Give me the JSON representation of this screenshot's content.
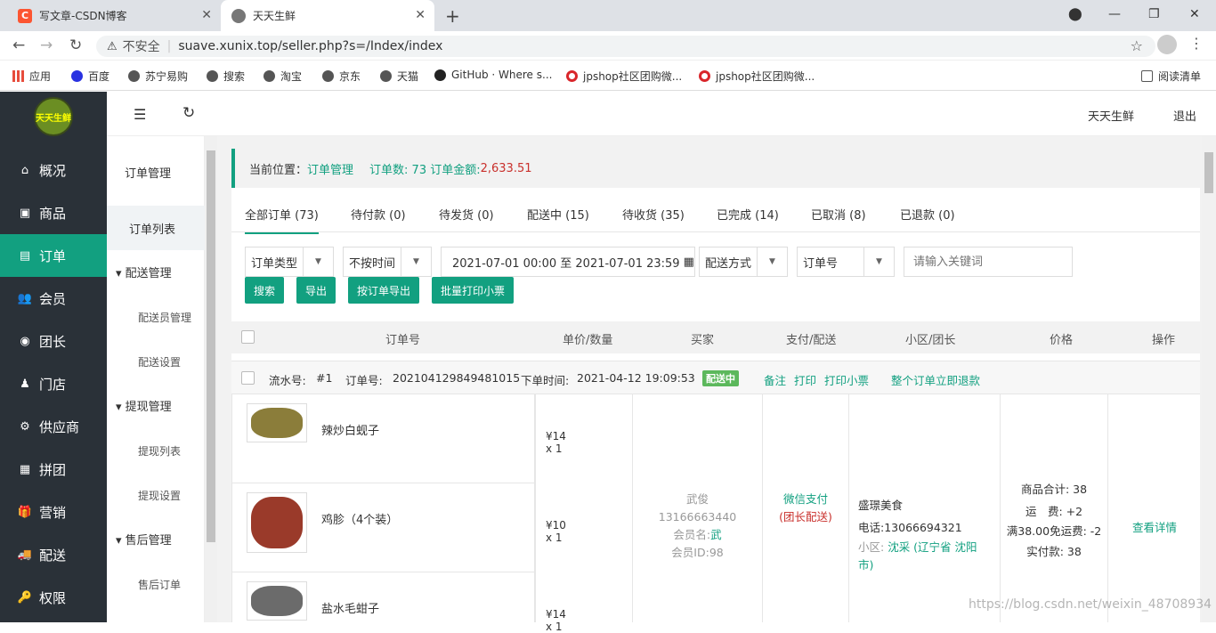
{
  "browser": {
    "tabs": [
      {
        "title": "写文章-CSDN博客",
        "favicon": "C"
      },
      {
        "title": "天天生鲜",
        "favicon": "globe"
      }
    ],
    "security_label": "不安全",
    "url": "suave.xunix.top/seller.php?s=/Index/index"
  },
  "bookmarks": [
    "应用",
    "百度",
    "苏宁易购",
    "搜索",
    "淘宝",
    "京东",
    "天猫",
    "GitHub · Where s...",
    "jpshop社区团购微...",
    "jpshop社区团购微...",
    "阅读清单"
  ],
  "sidebar": {
    "logo_text": "天天生鲜",
    "items": [
      {
        "label": "概况",
        "icon": "home-icon"
      },
      {
        "label": "商品",
        "icon": "inbox-icon"
      },
      {
        "label": "订单",
        "icon": "document-icon"
      },
      {
        "label": "会员",
        "icon": "users-icon"
      },
      {
        "label": "团长",
        "icon": "badge-icon"
      },
      {
        "label": "门店",
        "icon": "store-icon"
      },
      {
        "label": "供应商",
        "icon": "supplier-icon"
      },
      {
        "label": "拼团",
        "icon": "group-icon"
      },
      {
        "label": "营销",
        "icon": "gift-icon"
      },
      {
        "label": "配送",
        "icon": "truck-icon"
      },
      {
        "label": "权限",
        "icon": "key-icon"
      }
    ]
  },
  "subnav": {
    "title": "订单管理",
    "current": "订单列表",
    "groups": [
      {
        "label": "配送管理",
        "subs": [
          "配送员管理",
          "配送设置"
        ]
      },
      {
        "label": "提现管理",
        "subs": [
          "提现列表",
          "提现设置"
        ]
      },
      {
        "label": "售后管理",
        "subs": [
          "售后订单"
        ]
      }
    ]
  },
  "topbar": {
    "shop_name": "天天生鲜",
    "logout": "退出"
  },
  "breadcrumb": {
    "prefix": "当前位置：",
    "location": "订单管理",
    "summary_label": "订单数: 73 订单金额: ",
    "amount": "2,633.51"
  },
  "order_tabs": [
    "全部订单 (73)",
    "待付款 (0)",
    "待发货 (0)",
    "配送中 (15)",
    "待收货 (35)",
    "已完成 (14)",
    "已取消 (8)",
    "已退款 (0)"
  ],
  "filters": {
    "order_type": "订单类型",
    "time_mode": "不按时间",
    "date_range": "2021-07-01 00:00 至 2021-07-01 23:59",
    "delivery": "配送方式",
    "field": "订单号",
    "keyword_placeholder": "请输入关键词"
  },
  "buttons": {
    "search": "搜索",
    "export": "导出",
    "export_by_order": "按订单导出",
    "batch_print": "批量打印小票"
  },
  "table_header": [
    "订单号",
    "单价/数量",
    "买家",
    "支付/配送",
    "小区/团长",
    "价格",
    "操作"
  ],
  "order": {
    "serial_label": "流水号:",
    "serial": "#1",
    "order_no_label": "订单号:",
    "order_no": "202104129849481015",
    "time_label": "下单时间:",
    "time": "2021-04-12  19:09:53",
    "status": "配送中",
    "actions": [
      "备注",
      "打印",
      "打印小票",
      "整个订单立即退款"
    ],
    "products": [
      {
        "name": "辣炒白蚬子",
        "price": "¥14 x 1"
      },
      {
        "name": "鸡胗（4个装）",
        "price": "¥10 x 1"
      },
      {
        "name": "盐水毛蚶子",
        "price": "¥14 x 1"
      }
    ],
    "buyer": {
      "name": "武俊",
      "phone": "13166663440",
      "member_label": "会员名:",
      "member_name": "武",
      "id_label": "会员ID:",
      "id": "98"
    },
    "payment": {
      "method": "微信支付",
      "delivery": "(团长配送)"
    },
    "community": {
      "name": "盛璟美食",
      "phone_label": "电话:",
      "phone": "13066694321",
      "area_label": "小区:",
      "area": "沈采 (辽宁省 沈阳市)"
    },
    "price": {
      "subtotal": "商品合计: 38",
      "freight": "运　费: +2",
      "discount": "满38.00免运费: -2",
      "paid": "实付款: 38"
    },
    "detail_link": "查看详情"
  },
  "watermark": "https://blog.csdn.net/weixin_48708934",
  "colors": {
    "accent": "#12a080",
    "sidebar_bg": "#2a3138",
    "amount_red": "#c9302c"
  }
}
